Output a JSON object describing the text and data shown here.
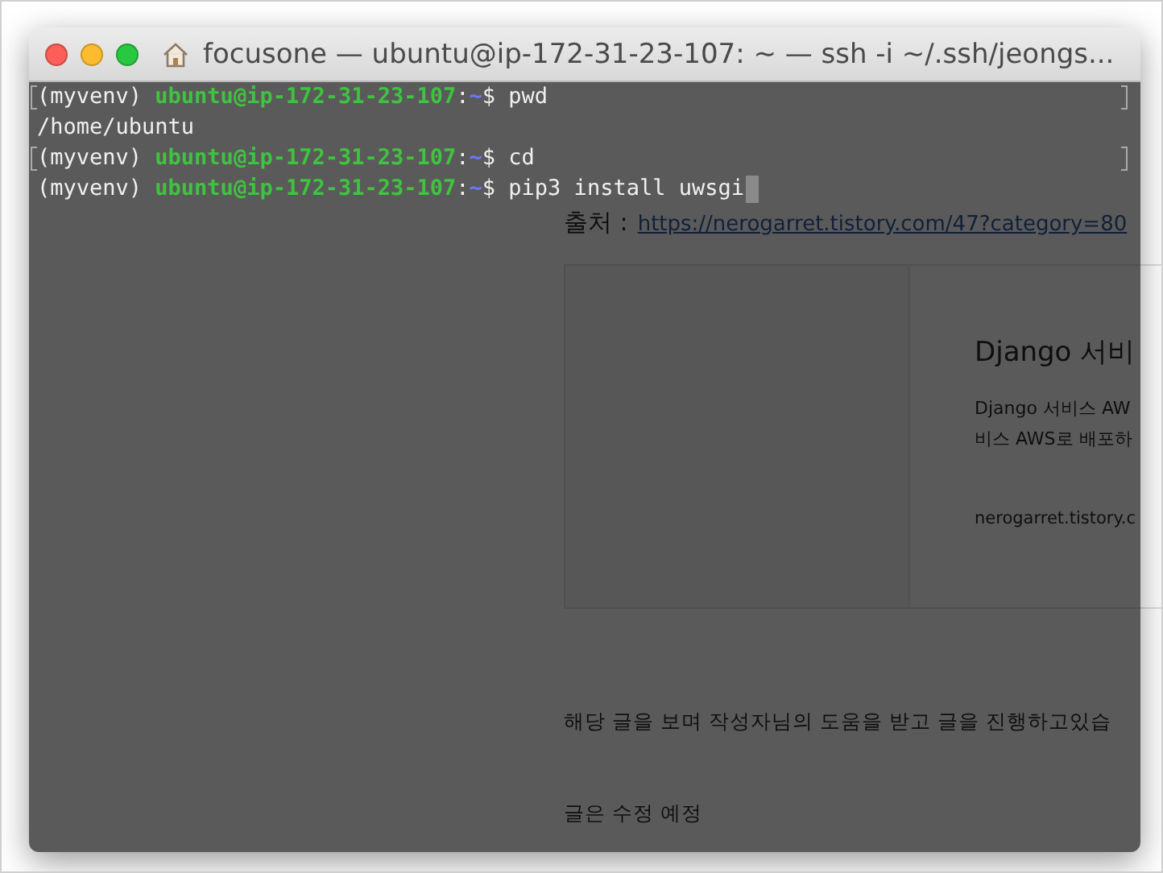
{
  "document": {
    "source_label": "출처 :",
    "source_link": "https://nerogarret.tistory.com/47?category=80",
    "link_card": {
      "title": "Django 서비",
      "description": [
        "Django 서비스 AW",
        "비스 AWS로 배포하"
      ],
      "domain": "nerogarret.tistory.c"
    },
    "paragraphs": [
      "해당 글을 보며 작성자님의 도움을 받고 글을 진행하고있습",
      "글은 수정 예정"
    ]
  },
  "terminal": {
    "title": "focusone — ubuntu@ip-172-31-23-107: ~ — ssh -i ~/.ssh/jeongs...",
    "lines": [
      {
        "kind": "prompt",
        "env": "(myvenv)",
        "user_host": "ubuntu@ip-172-31-23-107",
        "separator": ":",
        "path": "~",
        "prompt_char": "$",
        "command": "pwd",
        "marked": true,
        "cursor": false
      },
      {
        "kind": "output",
        "text": "/home/ubuntu",
        "marked": false
      },
      {
        "kind": "prompt",
        "env": "(myvenv)",
        "user_host": "ubuntu@ip-172-31-23-107",
        "separator": ":",
        "path": "~",
        "prompt_char": "$",
        "command": "cd",
        "marked": true,
        "cursor": false
      },
      {
        "kind": "prompt",
        "env": "(myvenv)",
        "user_host": "ubuntu@ip-172-31-23-107",
        "separator": ":",
        "path": "~",
        "prompt_char": "$",
        "command": "pip3 install uwsgi",
        "marked": false,
        "cursor": true
      }
    ]
  }
}
